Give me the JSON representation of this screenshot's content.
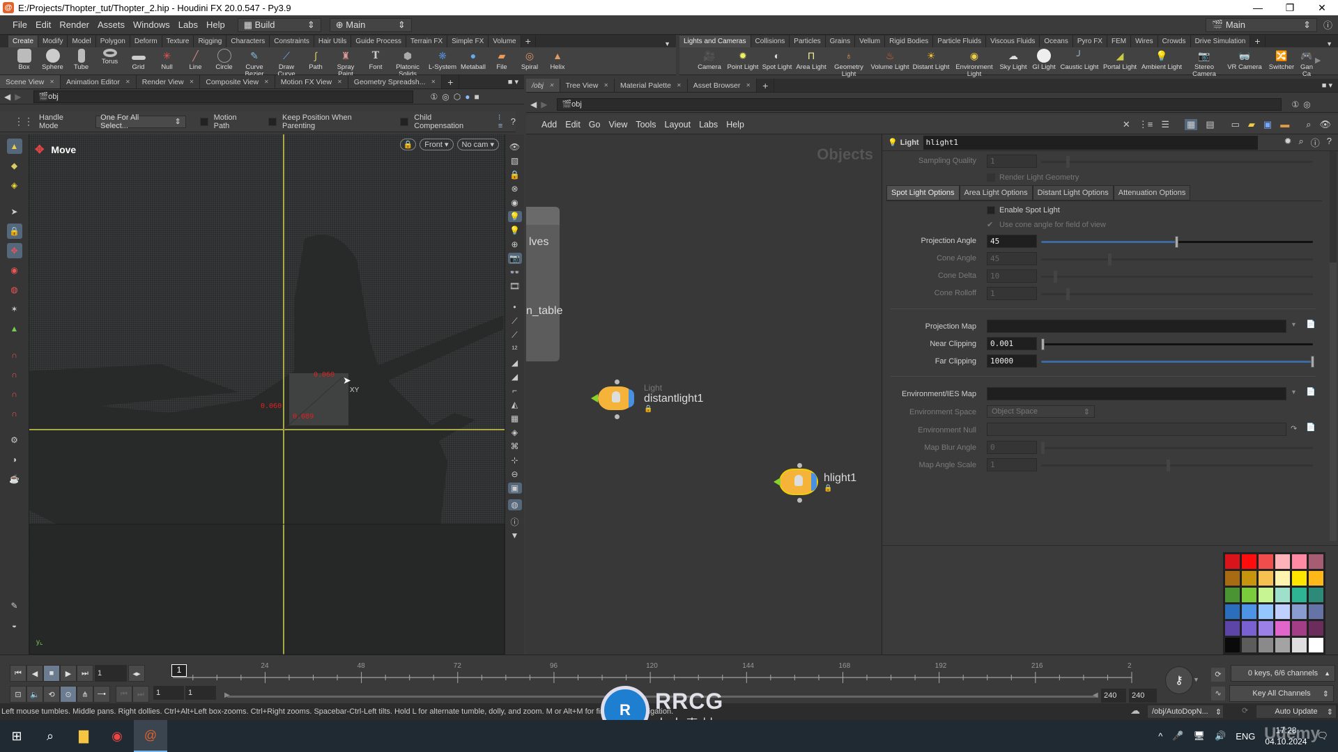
{
  "window": {
    "title": "E:/Projects/Thopter_tut/Thopter_2.hip - Houdini FX 20.0.547 - Py3.9",
    "controls": [
      "—",
      "❐",
      "✕"
    ]
  },
  "menubar": {
    "items": [
      "File",
      "Edit",
      "Render",
      "Assets",
      "Windows",
      "Labs",
      "Help"
    ],
    "desktop": "Build",
    "context": "Main",
    "right_desktop": "Main"
  },
  "shelf_left": {
    "tabs": [
      "Create",
      "Modify",
      "Model",
      "Polygon",
      "Deform",
      "Texture",
      "Rigging",
      "Characters",
      "Constraints",
      "Hair Utils",
      "Guide Process",
      "Terrain FX",
      "Simple FX",
      "Volume"
    ],
    "active_tab": "Create",
    "tools": [
      {
        "label": "Box",
        "icon": "box-icon"
      },
      {
        "label": "Sphere",
        "icon": "sphere-icon"
      },
      {
        "label": "Tube",
        "icon": "tube-icon"
      },
      {
        "label": "Torus",
        "icon": "torus-icon"
      },
      {
        "label": "Grid",
        "icon": "grid-icon"
      },
      {
        "label": "Null",
        "icon": "null-icon"
      },
      {
        "label": "Line",
        "icon": "line-icon"
      },
      {
        "label": "Circle",
        "icon": "circle-icon"
      },
      {
        "label": "Curve Bezier",
        "icon": "curve-bezier-icon"
      },
      {
        "label": "Draw Curve",
        "icon": "draw-curve-icon"
      },
      {
        "label": "Path",
        "icon": "path-icon"
      },
      {
        "label": "Spray Paint",
        "icon": "spray-paint-icon"
      },
      {
        "label": "Font",
        "icon": "font-icon"
      },
      {
        "label": "Platonic Solids",
        "icon": "platonic-icon"
      },
      {
        "label": "L-System",
        "icon": "lsystem-icon"
      },
      {
        "label": "Metaball",
        "icon": "metaball-icon"
      },
      {
        "label": "File",
        "icon": "file-icon"
      },
      {
        "label": "Spiral",
        "icon": "spiral-icon"
      },
      {
        "label": "Helix",
        "icon": "helix-icon"
      }
    ]
  },
  "shelf_right": {
    "tabs": [
      "Lights and Cameras",
      "Collisions",
      "Particles",
      "Grains",
      "Vellum",
      "Rigid Bodies",
      "Particle Fluids",
      "Viscous Fluids",
      "Oceans",
      "Pyro FX",
      "FEM",
      "Wires",
      "Crowds",
      "Drive Simulation"
    ],
    "active_tab": "Lights and Cameras",
    "tools": [
      {
        "label": "Camera",
        "icon": "camera-icon"
      },
      {
        "label": "Point Light",
        "icon": "point-light-icon"
      },
      {
        "label": "Spot Light",
        "icon": "spot-light-icon"
      },
      {
        "label": "Area Light",
        "icon": "area-light-icon"
      },
      {
        "label": "Geometry Light",
        "icon": "geometry-light-icon"
      },
      {
        "label": "Volume Light",
        "icon": "volume-light-icon"
      },
      {
        "label": "Distant Light",
        "icon": "distant-light-icon"
      },
      {
        "label": "Environment Light",
        "icon": "environment-light-icon"
      },
      {
        "label": "Sky Light",
        "icon": "sky-light-icon"
      },
      {
        "label": "GI Light",
        "icon": "gi-light-icon"
      },
      {
        "label": "Caustic Light",
        "icon": "caustic-light-icon"
      },
      {
        "label": "Portal Light",
        "icon": "portal-light-icon"
      },
      {
        "label": "Ambient Light",
        "icon": "ambient-light-icon"
      },
      {
        "label": "Stereo Camera",
        "icon": "stereo-camera-icon"
      },
      {
        "label": "VR Camera",
        "icon": "vr-camera-icon"
      },
      {
        "label": "Switcher",
        "icon": "switcher-icon"
      },
      {
        "label": "Gan Ca",
        "icon": "gamepad-camera-icon"
      }
    ]
  },
  "left_pane": {
    "tabs": [
      "Scene View",
      "Animation Editor",
      "Render View",
      "Composite View",
      "Motion FX View",
      "Geometry Spreadsh..."
    ],
    "active_tab": "Scene View",
    "path": "obj",
    "options": {
      "handle_mode_label": "Handle Mode",
      "handle_mode_value": "One For All Select...",
      "motion_path": "Motion Path",
      "keep_position": "Keep Position When Parenting",
      "child_compensation": "Child Compensation"
    },
    "viewport": {
      "tool_name": "Move",
      "view": "Front",
      "camera": "No cam",
      "readouts": [
        "0.060",
        "0.060",
        "0.089"
      ],
      "handle_label": "XY"
    }
  },
  "right_pane": {
    "tabs": [
      "/obj",
      "Tree View",
      "Material Palette",
      "Asset Browser"
    ],
    "active_tab": "/obj",
    "path": "obj",
    "network_menu": [
      "Add",
      "Edit",
      "Go",
      "View",
      "Tools",
      "Layout",
      "Labs",
      "Help"
    ],
    "network_title": "Objects",
    "nodes": [
      {
        "name": "lves",
        "type": "subnet-partial"
      },
      {
        "name": "n_table",
        "type": "subnet-partial"
      },
      {
        "name": "distantlight1",
        "type_label": "Light",
        "selected": false
      },
      {
        "name": "hlight1",
        "type_label": "",
        "selected": true
      }
    ]
  },
  "parameters": {
    "node_type": "Light",
    "node_name": "hlight1",
    "sampling_quality": {
      "label": "Sampling Quality",
      "value": "1"
    },
    "render_light_geometry": "Render Light Geometry",
    "tabs": [
      "Spot Light Options",
      "Area Light Options",
      "Distant Light Options",
      "Attenuation Options"
    ],
    "active_tab": "Spot Light Options",
    "enable_spot_light": "Enable Spot Light",
    "use_cone_angle": "Use cone angle for field of view",
    "projection_angle": {
      "label": "Projection Angle",
      "value": "45",
      "slider": 0.5
    },
    "cone_angle": {
      "label": "Cone Angle",
      "value": "45"
    },
    "cone_delta": {
      "label": "Cone Delta",
      "value": "10"
    },
    "cone_rolloff": {
      "label": "Cone Rolloff",
      "value": "1"
    },
    "projection_map": {
      "label": "Projection Map",
      "value": ""
    },
    "near_clipping": {
      "label": "Near Clipping",
      "value": "0.001",
      "slider": 0.0
    },
    "far_clipping": {
      "label": "Far Clipping",
      "value": "10000",
      "slider": 1.0
    },
    "env_map": {
      "label": "Environment/IES Map",
      "value": ""
    },
    "env_space": {
      "label": "Environment Space",
      "value": "Object Space"
    },
    "env_null": {
      "label": "Environment Null",
      "value": ""
    },
    "map_blur_angle": {
      "label": "Map Blur Angle",
      "value": "0"
    },
    "map_angle_scale": {
      "label": "Map Angle Scale",
      "value": "1"
    },
    "palette": [
      "#d9141a",
      "#ff0d0d",
      "#f24d4d",
      "#ffb3b8",
      "#ff8aa3",
      "#a65c73",
      "#a86b14",
      "#c7940d",
      "#f7c152",
      "#fff3b0",
      "#ffe600",
      "#ffb81a",
      "#4a9433",
      "#7acc3d",
      "#c7f594",
      "#9ee0cc",
      "#2eb394",
      "#2e8a78",
      "#2a6ebd",
      "#4d94e6",
      "#94c7ff",
      "#bfcfff",
      "#8a9ccf",
      "#6673a6",
      "#5c45a6",
      "#7a61d1",
      "#9c80e6",
      "#e066cc",
      "#a33d85",
      "#6b2e5c",
      "#0a0a0a",
      "#5c5c5c",
      "#8a8a8a",
      "#a3a3a3",
      "#dedede",
      "#ffffff"
    ]
  },
  "playbar": {
    "current_frame": "1",
    "frame_marker": "1",
    "ticks": [
      "24",
      "48",
      "72",
      "96",
      "120",
      "144",
      "168",
      "192",
      "216",
      "2"
    ],
    "range_start": "1",
    "range_start2": "1",
    "range_end": "240",
    "range_end2": "240",
    "keys_status": "0 keys, 6/6 channels",
    "key_mode": "Key All Channels"
  },
  "statusbar": {
    "message": "Left mouse tumbles. Middle pans. Right dollies. Ctrl+Alt+Left box-zooms. Ctrl+Right zooms. Spacebar-Ctrl-Left tilts. Hold L for alternate tumble, dolly, and zoom. M or Alt+M for first person navigation.",
    "path": "/obj/AutoDopN...",
    "update_mode": "Auto Update"
  },
  "taskbar": {
    "lang": "ENG",
    "time": "17:28",
    "date": "04.10.2024"
  },
  "watermark": {
    "brand": "RRCG",
    "sub": "人人素材",
    "udemy": "Udemy"
  }
}
